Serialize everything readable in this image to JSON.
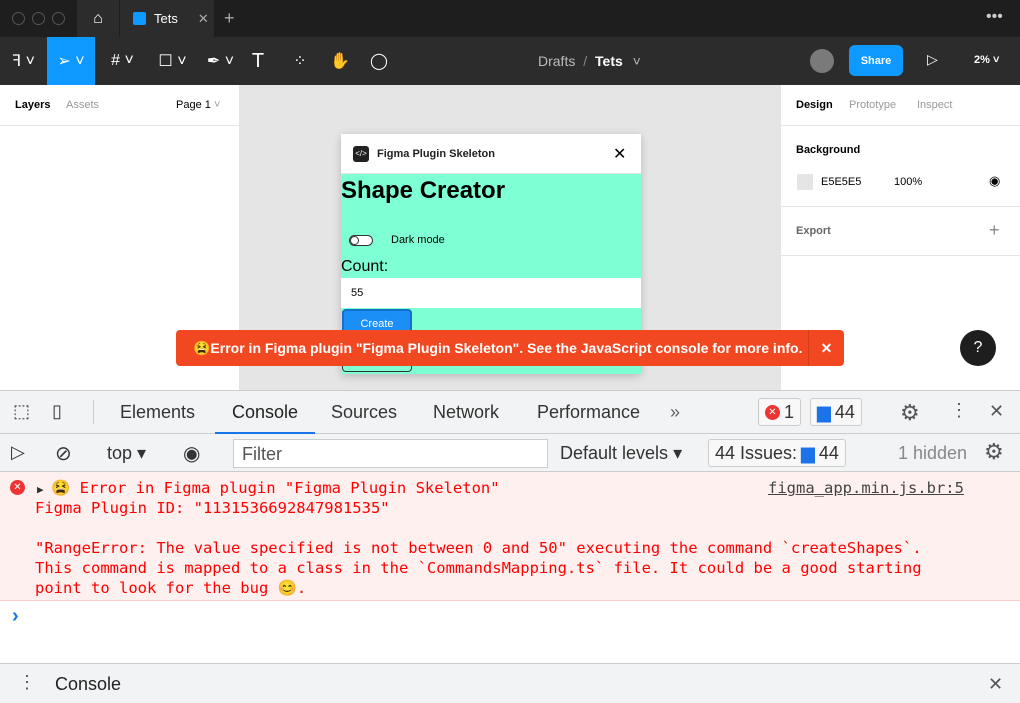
{
  "tabs": {
    "file_tab": "Tets"
  },
  "toolbar": {
    "breadcrumb_parent": "Drafts",
    "breadcrumb_sep": "/",
    "file_name": "Tets",
    "share": "Share",
    "zoom": "2%",
    "accent": "#0d99ff"
  },
  "left_panel": {
    "layers": "Layers",
    "assets": "Assets",
    "page": "Page 1"
  },
  "right_panel": {
    "design": "Design",
    "prototype": "Prototype",
    "inspect": "Inspect",
    "background_label": "Background",
    "bg_hex": "E5E5E5",
    "bg_opacity": "100%",
    "export_label": "Export"
  },
  "plugin": {
    "title": "Figma Plugin Skeleton",
    "heading": "Shape Creator",
    "dark_mode": "Dark mode",
    "count_label": "Count:",
    "count_value": "55",
    "create": "Create",
    "bg": "#7fffd4"
  },
  "toast": {
    "message": "😫Error in Figma plugin \"Figma Plugin Skeleton\". See the JavaScript console for more info."
  },
  "help": "?",
  "devtools": {
    "tabs": [
      "Elements",
      "Console",
      "Sources",
      "Network",
      "Performance"
    ],
    "more": "»",
    "error_count": "1",
    "message_count": "44",
    "context": "top",
    "filter_placeholder": "Filter",
    "levels": "Default levels",
    "issues_label": "44 Issues:",
    "issues_count": "44",
    "hidden": "1 hidden",
    "error": {
      "line1": "😫 Error in Figma plugin \"Figma Plugin Skeleton\"",
      "source": "figma_app.min.js.br:5",
      "line2": "Figma Plugin ID: \"1131536692847981535\"",
      "line3": "\"RangeError: The value specified is not between 0 and 50\" executing the command `createShapes`.",
      "line4": "This command is mapped to a class in the `CommandsMapping.ts` file. It could be a good starting",
      "line5": "point to look for the bug 😊."
    },
    "prompt": "›",
    "drawer_tab": "Console"
  }
}
